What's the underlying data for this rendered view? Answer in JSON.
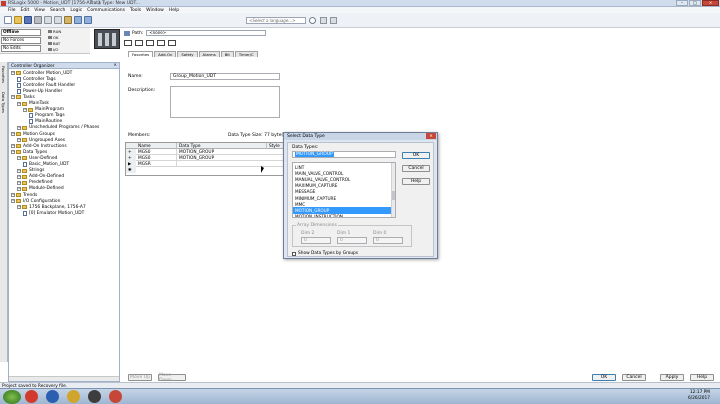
{
  "window": {
    "title_left": "RSLogix 5000 - Motion_UDT [1756-A7 ...]",
    "title_right": "Data Type: New UDT..."
  },
  "menu": [
    "File",
    "Edit",
    "View",
    "Search",
    "Logic",
    "Communications",
    "Tools",
    "Window",
    "Help"
  ],
  "toolbar": {
    "language_placeholder": "<Select a language...>"
  },
  "status_panel": {
    "mode": "Offline",
    "forces": "No Forces",
    "edits": "No Edits",
    "indicators": [
      "RUN",
      "OK",
      "BAT",
      "I/O"
    ]
  },
  "path": {
    "label": "Path:",
    "value": "<none>"
  },
  "instruction_tabs": [
    "Favorites",
    "Add-On",
    "Safety",
    "Alarms",
    "Bit",
    "Timer/C"
  ],
  "side_tabs": [
    "Favorites",
    "Data Types"
  ],
  "organizer": {
    "title": "Controller Organizer",
    "items": [
      {
        "label": "Controller Motion_UDT",
        "level": 0,
        "type": "folder"
      },
      {
        "label": "Controller Tags",
        "level": 1,
        "type": "doc"
      },
      {
        "label": "Controller Fault Handler",
        "level": 1,
        "type": "doc"
      },
      {
        "label": "Power-Up Handler",
        "level": 1,
        "type": "doc"
      },
      {
        "label": "Tasks",
        "level": 0,
        "type": "folder"
      },
      {
        "label": "MainTask",
        "level": 1,
        "type": "folder"
      },
      {
        "label": "MainProgram",
        "level": 2,
        "type": "folder"
      },
      {
        "label": "Program Tags",
        "level": 3,
        "type": "doc"
      },
      {
        "label": "MainRoutine",
        "level": 3,
        "type": "doc"
      },
      {
        "label": "Unscheduled Programs / Phases",
        "level": 1,
        "type": "folder"
      },
      {
        "label": "Motion Groups",
        "level": 0,
        "type": "folder"
      },
      {
        "label": "Ungrouped Axes",
        "level": 1,
        "type": "folder"
      },
      {
        "label": "Add-On Instructions",
        "level": 0,
        "type": "folder"
      },
      {
        "label": "Data Types",
        "level": 0,
        "type": "folder"
      },
      {
        "label": "User-Defined",
        "level": 1,
        "type": "folder"
      },
      {
        "label": "Basic_Motion_UDT",
        "level": 2,
        "type": "doc"
      },
      {
        "label": "Strings",
        "level": 1,
        "type": "folder"
      },
      {
        "label": "Add-On-Defined",
        "level": 1,
        "type": "folder"
      },
      {
        "label": "Predefined",
        "level": 1,
        "type": "folder"
      },
      {
        "label": "Module-Defined",
        "level": 1,
        "type": "folder"
      },
      {
        "label": "Trends",
        "level": 0,
        "type": "folder"
      },
      {
        "label": "I/O Configuration",
        "level": 0,
        "type": "folder"
      },
      {
        "label": "1756 Backplane, 1756-A7",
        "level": 1,
        "type": "folder"
      },
      {
        "label": "[0] Emulator Motion_UDT",
        "level": 2,
        "type": "doc"
      }
    ]
  },
  "udt": {
    "name_label": "Name:",
    "name_value": "Group_Motion_UDT",
    "description_label": "Description:",
    "members_label": "Members:",
    "size_label": "Data Type Size: 77 byte(s)",
    "columns": [
      "Name",
      "Data Type",
      "Style"
    ],
    "rows": [
      {
        "name": "MGS0",
        "type": "MOTION_GROUP"
      },
      {
        "name": "MGS0",
        "type": "MOTION_GROUP"
      },
      {
        "name": "MGSR",
        "type": ""
      }
    ],
    "move_up": "Move Up",
    "move_down": "Move Down",
    "ok": "OK",
    "cancel": "Cancel",
    "apply": "Apply",
    "help": "Help"
  },
  "dialog": {
    "title": "Select Data Type",
    "data_types_label": "Data Types:",
    "input_value": "MOTION_GROUP",
    "list": [
      "LINT",
      "MAIN_VALVE_CONTROL",
      "MANUAL_VALVE_CONTROL",
      "MAXIMUM_CAPTURE",
      "MESSAGE",
      "MINIMUM_CAPTURE",
      "MMC",
      "MOTION_GROUP",
      "MOTION_INSTRUCTION"
    ],
    "selected_index": 7,
    "ok": "OK",
    "cancel": "Cancel",
    "help": "Help",
    "array_label": "Array Dimensions",
    "dims": [
      {
        "label": "Dim 2",
        "value": "0"
      },
      {
        "label": "Dim 1",
        "value": "0"
      },
      {
        "label": "Dim 0",
        "value": "0"
      }
    ],
    "group_checkbox_label": "Show Data Types by Groups"
  },
  "status_bar": {
    "text": "Project saved to Recovery file."
  },
  "taskbar": {
    "time": "12:17 PM",
    "date": "6/26/2017"
  }
}
